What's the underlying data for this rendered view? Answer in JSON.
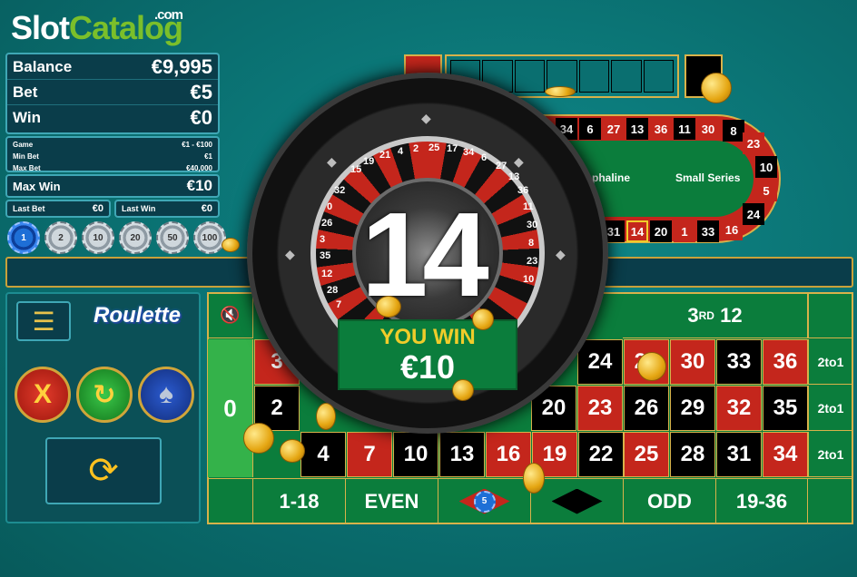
{
  "logo": {
    "slot": "Slot",
    "catalog": "Catalog",
    "dotcom": ".com"
  },
  "info": {
    "balance_label": "Balance",
    "balance_value": "€9,995",
    "bet_label": "Bet",
    "bet_value": "€5",
    "win_label": "Win",
    "win_value": "€0",
    "game_label": "Game",
    "game_value": "€1 - €100",
    "min_bet_label": "Min Bet",
    "min_bet_value": "€1",
    "max_bet_label": "Max Bet",
    "max_bet_value": "€40,000",
    "max_win_label": "Max Win",
    "max_win_value": "€10",
    "last_bet_label": "Last Bet",
    "last_bet_value": "€0",
    "last_win_label": "Last Win",
    "last_win_value": "€0"
  },
  "chips": [
    "1",
    "2",
    "10",
    "20",
    "50",
    "100"
  ],
  "controls": {
    "menu_icon": "☰",
    "roulette_logo": "Roulette",
    "clear_label": "X",
    "redo_icon": "↻",
    "spade_icon": "♠",
    "spin_icon": "⟳"
  },
  "racetrack": {
    "top": [
      "34",
      "6",
      "27",
      "13",
      "36",
      "11",
      "30",
      "8"
    ],
    "right": [
      "23",
      "10",
      "5",
      "24"
    ],
    "bottom": [
      "31",
      "14",
      "20",
      "1",
      "33",
      "16"
    ],
    "label_orphelins": "phaline",
    "label_small": "Small Series"
  },
  "table": {
    "sound_icon": "🔇",
    "zero": "0",
    "dozen3": "3RD 12",
    "dozen3_main": "3",
    "dozen3_sup": "RD",
    "dozen3_num": "12",
    "row1": [
      "3",
      "24",
      "27",
      "30",
      "33",
      "36"
    ],
    "row2": [
      "2",
      "20",
      "23",
      "26",
      "29",
      "32",
      "35"
    ],
    "row3": [
      "4",
      "7",
      "10",
      "13",
      "16",
      "19",
      "22",
      "25",
      "28",
      "31",
      "34"
    ],
    "col_bet": "2to1",
    "outside": [
      "1-18",
      "EVEN",
      "ODD",
      "19-36"
    ],
    "chip_on_red": "5"
  },
  "wheel": {
    "result": "14",
    "win_title": "YOU WIN",
    "win_amount": "€10",
    "numbers_top": [
      "21",
      "4",
      "2",
      "25",
      "17",
      "34",
      "6",
      "27",
      "13",
      "36"
    ],
    "numbers_left": [
      "32",
      "0",
      "26",
      "3",
      "35",
      "12",
      "28",
      "7"
    ],
    "numbers_right": [
      "11",
      "30",
      "8",
      "23",
      "10"
    ],
    "numbers_top_left": [
      "15",
      "19"
    ]
  },
  "colors": {
    "red": "#c4261c",
    "black": "#000000",
    "felt": "#0b7d3c",
    "gold": "#d8b24a",
    "teal_bg": "#0a6f70"
  }
}
